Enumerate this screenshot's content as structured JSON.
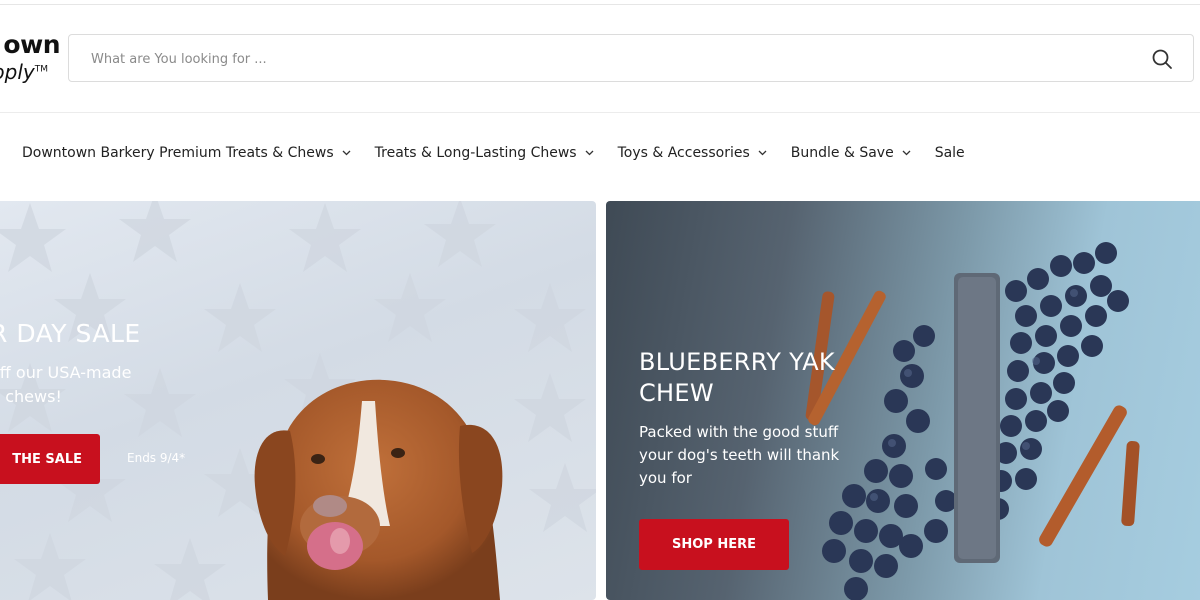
{
  "brand": {
    "logo_line1": "own",
    "logo_line2": "oply",
    "logo_tm": "TM"
  },
  "search": {
    "placeholder": "What are You looking for ...",
    "icon": "search-icon"
  },
  "nav": {
    "items": [
      {
        "label": "Downtown Barkery Premium Treats & Chews",
        "has_dropdown": true
      },
      {
        "label": "Treats & Long-Lasting Chews",
        "has_dropdown": true
      },
      {
        "label": "Toys & Accessories",
        "has_dropdown": true
      },
      {
        "label": "Bundle & Save",
        "has_dropdown": true
      },
      {
        "label": "Sale",
        "has_dropdown": false
      }
    ]
  },
  "banners": {
    "left": {
      "title": "R DAY SALE",
      "text_line1": "off our USA-made",
      "text_line2": "d chews!",
      "button_label": "THE SALE",
      "note": "Ends 9/4*"
    },
    "right": {
      "title_line1": "BLUEBERRY YAK",
      "title_line2": "CHEW",
      "text_line1": "Packed with the good stuff",
      "text_line2": "your dog's teeth will thank",
      "text_line3": "you for",
      "button_label": "SHOP HERE"
    }
  },
  "colors": {
    "accent": "#c8101e",
    "left_banner_bg": "#d9e0e8",
    "right_banner_bg": "#8fb6c9"
  }
}
